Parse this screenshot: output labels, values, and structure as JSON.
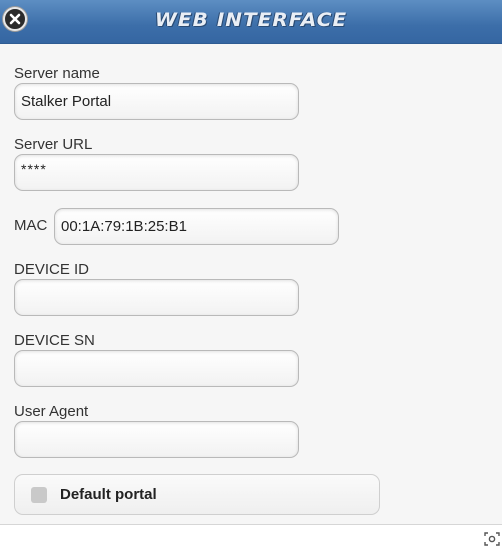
{
  "header": {
    "title": "WEB INTERFACE",
    "close_icon": "close-icon"
  },
  "form": {
    "server_name": {
      "label": "Server name",
      "value": "Stalker Portal"
    },
    "server_url": {
      "label": "Server URL",
      "value": "****"
    },
    "mac": {
      "label": "MAC",
      "value": "00:1A:79:1B:25:B1"
    },
    "device_id": {
      "label": "DEVICE ID",
      "value": ""
    },
    "device_sn": {
      "label": "DEVICE SN",
      "value": ""
    },
    "user_agent": {
      "label": "User Agent",
      "value": ""
    },
    "default_portal": {
      "label": "Default portal",
      "checked": false
    }
  },
  "footer": {
    "icon": "screenshot-icon"
  },
  "colors": {
    "header_bg": "#3c6ea9",
    "page_bg": "#f6f6f6"
  }
}
